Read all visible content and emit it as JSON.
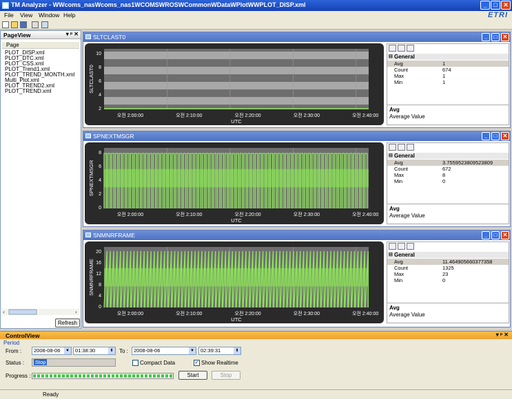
{
  "window": {
    "title": "TM Analyzer - WWcoms_nasWcoms_nas1WCOMSWROSWCommonWDataWPlotWWPLOT_DISP.xml",
    "logo": "ETRI"
  },
  "menu": [
    "File",
    "View",
    "Window",
    "Help"
  ],
  "pageview": {
    "title": "PageView",
    "controls": "▾ p ✕",
    "column": "Page",
    "items": [
      "PLOT_DISP.xml",
      "PLOT_DTC.xml",
      "PLOT_CSS.xml",
      "PLOT_Trend1.xml",
      "PLOT_TREND_MONTH.xml",
      "Multi_Plot.xml",
      "PLOT_TREND2.xml",
      "PLOT_TREND.xml"
    ],
    "refresh_label": "Refresh"
  },
  "panels": [
    {
      "title": "SLTCLAST0",
      "ylabel": "SLTCLAST0",
      "xlabel": "UTC",
      "yticks": [
        "10",
        "8",
        "6",
        "4",
        "2"
      ],
      "xticks": [
        "오전 2:00:00",
        "오전 2:10:00",
        "오전 2:20:00",
        "오전 2:30:00",
        "오전 2:40:00"
      ],
      "props": {
        "category": "General",
        "rows": [
          [
            "Avg",
            "1"
          ],
          [
            "Count",
            "674"
          ],
          [
            "Max",
            "1"
          ],
          [
            "Min",
            "1"
          ]
        ],
        "desc_title": "Avg",
        "desc_text": "Average Value"
      }
    },
    {
      "title": "SPNEXTMSGR",
      "ylabel": "SPNEXTMSGR",
      "xlabel": "UTC",
      "yticks": [
        "8",
        "6",
        "4",
        "2",
        "0"
      ],
      "xticks": [
        "오전 2:00:00",
        "오전 2:10:00",
        "오전 2:20:00",
        "오전 2:30:00",
        "오전 2:40:00"
      ],
      "props": {
        "category": "General",
        "rows": [
          [
            "Avg",
            "3.7559523809523809"
          ],
          [
            "Count",
            "672"
          ],
          [
            "Max",
            "8"
          ],
          [
            "Min",
            "0"
          ]
        ],
        "desc_title": "Avg",
        "desc_text": "Average Value"
      }
    },
    {
      "title": "SNMNRFRAME",
      "ylabel": "SNMNRFRAME",
      "xlabel": "UTC",
      "yticks": [
        "20",
        "16",
        "12",
        "8",
        "4",
        "0"
      ],
      "xticks": [
        "오전 2:00:00",
        "오전 2:10:00",
        "오전 2:20:00",
        "오전 2:30:00",
        "오전 2:40:00"
      ],
      "props": {
        "category": "General",
        "rows": [
          [
            "Avg",
            "11.464905660377358"
          ],
          [
            "Count",
            "1325"
          ],
          [
            "Max",
            "23"
          ],
          [
            "Min",
            "0"
          ]
        ],
        "desc_title": "Avg",
        "desc_text": "Average Value"
      }
    }
  ],
  "control": {
    "title": "ControlView",
    "period_label": "Period",
    "from_label": "From :",
    "from_date": "2008-08-06",
    "from_time": "01:38:30",
    "to_label": "To :",
    "to_date": "2008-08-06",
    "to_time": "02:39:31",
    "status_label": "Status :",
    "status_value": "Stop",
    "compact_label": "Compact Data",
    "compact_checked": false,
    "realtime_label": "Show Realtime",
    "realtime_checked": true,
    "progress_label": "Progress :",
    "progress": 1.0,
    "start_label": "Start",
    "stop_label": "Stop"
  },
  "status": {
    "text": "Ready"
  },
  "colors": {
    "series": "#8ee65a",
    "panel_header": "#5a7fd0",
    "control_header": "#f0a030"
  }
}
